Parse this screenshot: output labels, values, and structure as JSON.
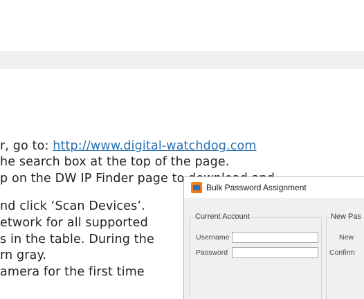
{
  "document": {
    "line_1": {
      "prefix": "r, go to: ",
      "link_text": "http://www.digital-watchdog.com"
    },
    "line_2": "he search box at the top of the page.",
    "line_3": "p  on  the  DW  IP  Finder  page  to  download  and",
    "line_4": "nd  click  ‘Scan  Devices’.",
    "line_5": "etwork  for  all  supported",
    "line_6": "s in the table. During the",
    "line_7": "rn gray.",
    "line_8": "amera for the first time"
  },
  "dialog": {
    "title": "Bulk Password Assignment",
    "icon": "dw-app-icon",
    "current_account": {
      "legend": "Current Account",
      "username_label": "Username",
      "password_label": "Password",
      "username_value": "",
      "password_value": ""
    },
    "new_password": {
      "legend": "New Pas",
      "new_label": "New",
      "confirm_label": "Confirm"
    }
  },
  "colors": {
    "link": "#2a6fb0",
    "band": "#f0f0f0",
    "app_icon_orange": "#f26a00",
    "app_icon_blue": "#2d6fb8"
  }
}
